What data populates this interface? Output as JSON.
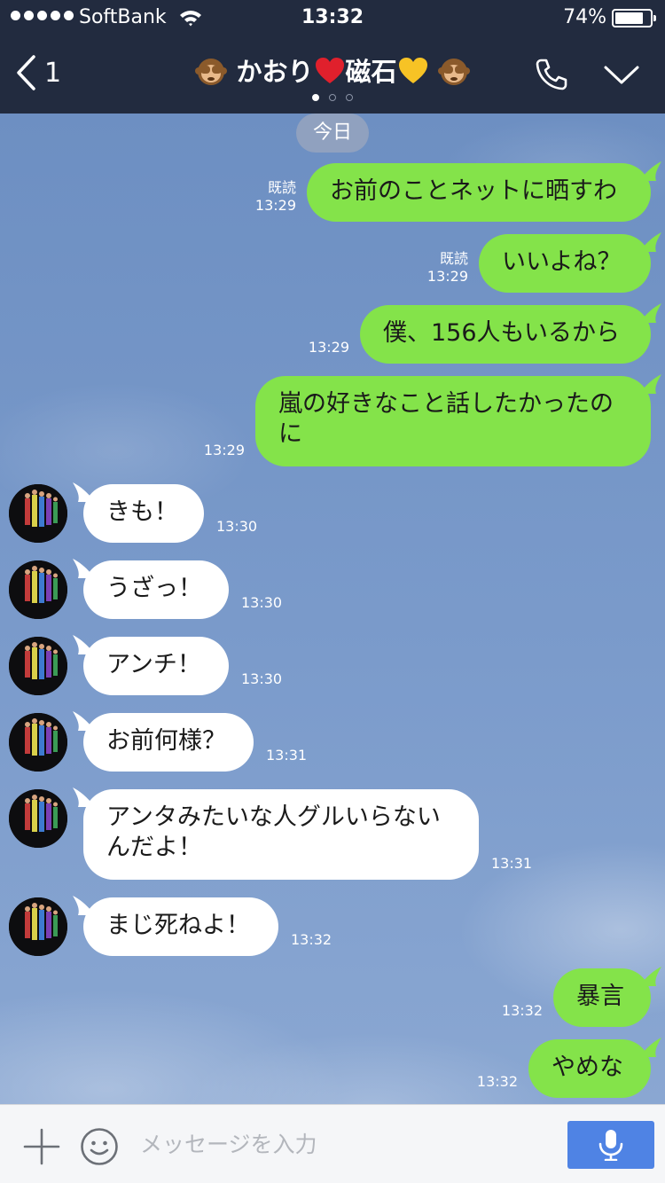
{
  "status_bar": {
    "carrier": "SoftBank",
    "time": "13:32",
    "battery": "74%",
    "battery_level": 0.74
  },
  "header": {
    "back_count": "1",
    "title_name": "かおり",
    "title_suffix": "磁石",
    "page_count": 3,
    "active_page": 0
  },
  "chat": {
    "date_label": "今日",
    "messages": [
      {
        "side": "out",
        "text": "お前のことネットに晒すわ",
        "read": "既読",
        "time": "13:29"
      },
      {
        "side": "out",
        "text": "いいよね？",
        "read": "既読",
        "time": "13:29"
      },
      {
        "side": "out",
        "text": "僕、156人もいるから",
        "time": "13:29"
      },
      {
        "side": "out",
        "text": "嵐の好きなこと話したかったのに",
        "time": "13:29"
      },
      {
        "side": "in",
        "text": "きも！",
        "time": "13:30"
      },
      {
        "side": "in",
        "text": "うざっ！",
        "time": "13:30"
      },
      {
        "side": "in",
        "text": "アンチ！",
        "time": "13:30"
      },
      {
        "side": "in",
        "text": "お前何様？",
        "time": "13:31"
      },
      {
        "side": "in",
        "text": "アンタみたいな人グルいらないんだよ！",
        "time": "13:31"
      },
      {
        "side": "in",
        "text": "まじ死ねよ！",
        "time": "13:32"
      },
      {
        "side": "out",
        "text": "暴言",
        "time": "13:32"
      },
      {
        "side": "out",
        "text": "やめな",
        "time": "13:32"
      }
    ]
  },
  "composer": {
    "placeholder": "メッセージを入力"
  },
  "colors": {
    "header_bg": "#222b3f",
    "outgoing_bubble": "#84e34a",
    "incoming_bubble": "#ffffff",
    "mic_button": "#4f83e4"
  },
  "icons": [
    "back-chevron-icon",
    "see-no-evil-monkey-icon",
    "red-heart-icon",
    "yellow-heart-icon",
    "phone-icon",
    "chevron-down-icon",
    "plus-icon",
    "smiley-icon",
    "microphone-icon",
    "wifi-icon",
    "battery-icon"
  ]
}
